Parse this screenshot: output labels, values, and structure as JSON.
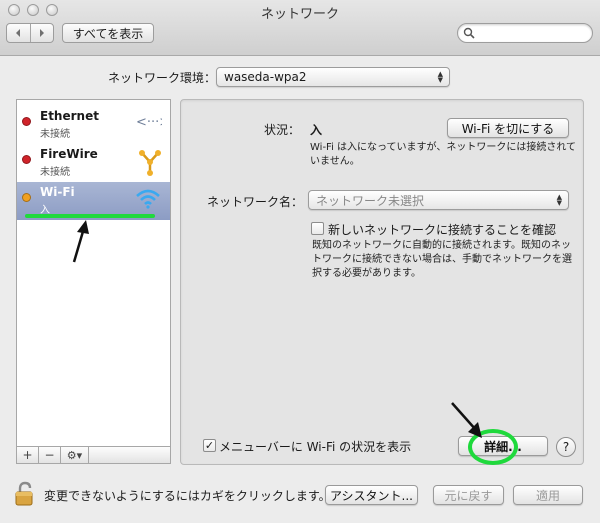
{
  "window": {
    "title": "ネットワーク"
  },
  "toolbar": {
    "back_icon": "chevron-left-icon",
    "forward_icon": "chevron-right-icon",
    "show_all_label": "すべてを表示",
    "search_placeholder": ""
  },
  "location": {
    "label": "ネットワーク環境：",
    "value": "waseda-wpa2"
  },
  "services": [
    {
      "name": "Ethernet",
      "status": "未接続",
      "dot_color": "#d0232a",
      "icon": "ethernet-icon",
      "selected": false
    },
    {
      "name": "FireWire",
      "status": "未接続",
      "dot_color": "#d0232a",
      "icon": "firewire-icon",
      "selected": false
    },
    {
      "name": "Wi-Fi",
      "status": "入",
      "dot_color": "#f0a020",
      "icon": "wifi-icon",
      "selected": true
    }
  ],
  "list_toolbar": {
    "add": "+",
    "remove": "−",
    "gear": "⚙▾"
  },
  "detail": {
    "status_label": "状況：",
    "status_value": "入",
    "wifi_off_button": "Wi-Fi を切にする",
    "status_description": "Wi-Fi は入になっていますが、ネットワークには接続されていません。",
    "network_name_label": "ネットワーク名：",
    "network_name_value": "ネットワーク未選択",
    "ask_to_join_label": "新しいネットワークに接続することを確認",
    "ask_to_join_checked": false,
    "ask_to_join_description": "既知のネットワークに自動的に接続されます。既知のネットワークに接続できない場合は、手動でネットワークを選択する必要があります。",
    "show_in_menubar_label": "メニューバーに Wi-Fi の状況を表示",
    "show_in_menubar_checked": true,
    "advanced_button": "詳細...",
    "help_button": "?"
  },
  "bottom": {
    "lock_text": "変更できないようにするにはカギをクリックします。",
    "assistant_button": "アシスタント...",
    "revert_button": "元に戻す",
    "apply_button": "適用"
  },
  "colors": {
    "highlight_green": "#1fd93c",
    "selected_row": "#8c9cc4"
  }
}
